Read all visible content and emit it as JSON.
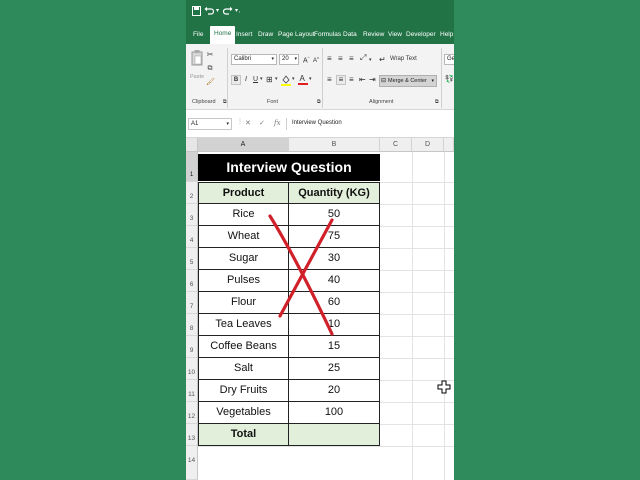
{
  "window": {
    "app_icons": [
      "save-icon",
      "undo-icon",
      "redo-icon"
    ]
  },
  "tabs": [
    "File",
    "Home",
    "Insert",
    "Draw",
    "Page Layout",
    "Formulas",
    "Data",
    "Review",
    "View",
    "Developer",
    "Help"
  ],
  "active_tab": "Home",
  "ribbon": {
    "clipboard": {
      "label": "Clipboard",
      "paste": "Paste"
    },
    "font": {
      "label": "Font",
      "name": "Calibri",
      "size": "20"
    },
    "alignment": {
      "label": "Alignment",
      "wrap_text": "Wrap Text",
      "merge_center": "Merge & Center"
    },
    "number": {
      "format": "Ge"
    }
  },
  "formula_bar": {
    "name_box": "A1",
    "fx": "fx",
    "content": "Interview Question"
  },
  "sheet": {
    "columns": [
      "A",
      "B",
      "C",
      "D"
    ],
    "rows": [
      "1",
      "2",
      "3",
      "4",
      "5",
      "6",
      "7",
      "8",
      "9",
      "10",
      "11",
      "12",
      "13",
      "14"
    ],
    "title": "Interview Question",
    "headers": {
      "product": "Product",
      "quantity": "Quantity (KG)"
    },
    "items": [
      {
        "product": "Rice",
        "qty": "50"
      },
      {
        "product": "Wheat",
        "qty": "75"
      },
      {
        "product": "Sugar",
        "qty": "30"
      },
      {
        "product": "Pulses",
        "qty": "40"
      },
      {
        "product": "Flour",
        "qty": "60"
      },
      {
        "product": "Tea Leaves",
        "qty": "10"
      },
      {
        "product": "Coffee Beans",
        "qty": "15"
      },
      {
        "product": "Salt",
        "qty": "25"
      },
      {
        "product": "Dry Fruits",
        "qty": "20"
      },
      {
        "product": "Vegetables",
        "qty": "100"
      }
    ],
    "total_label": "Total",
    "total_value": ""
  },
  "colors": {
    "excel_green": "#217346",
    "header_fill": "#e2efda",
    "title_fill": "#000000",
    "cross_mark": "#d0202a"
  }
}
